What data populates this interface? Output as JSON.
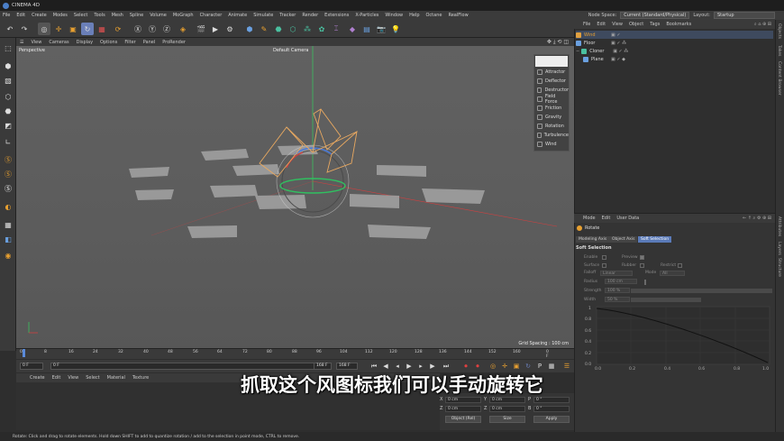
{
  "window": {
    "title": "CINEMA 4D"
  },
  "menubar": {
    "items": [
      "File",
      "Edit",
      "Create",
      "Modes",
      "Select",
      "Tools",
      "Mesh",
      "Spline",
      "Volume",
      "MoGraph",
      "Character",
      "Animate",
      "Simulate",
      "Tracker",
      "Render",
      "Extensions",
      "X-Particles",
      "Window",
      "Help",
      "Octane",
      "RealFlow"
    ],
    "node_space_label": "Node Space:",
    "node_space_value": "Current (Standard/Physical)",
    "layout_label": "Layout:",
    "layout_value": "Startup"
  },
  "viewport": {
    "menu": [
      "View",
      "Cameras",
      "Display",
      "Options",
      "Filter",
      "Panel",
      "ProRender"
    ],
    "label": "Perspective",
    "camera": "Default Camera",
    "grid_spacing": "Grid Spacing : 100 cm"
  },
  "force_menu": {
    "items": [
      "Attractor",
      "Deflector",
      "Destructor",
      "Field Force",
      "Friction",
      "Gravity",
      "Rotation",
      "Turbulence",
      "Wind"
    ]
  },
  "timeline": {
    "ticks": [
      "0",
      "8",
      "16",
      "24",
      "32",
      "40",
      "48",
      "56",
      "64",
      "72",
      "80",
      "88",
      "96",
      "104",
      "112",
      "120",
      "128",
      "136",
      "144",
      "152",
      "160"
    ],
    "end_frame": "0 F"
  },
  "playbar": {
    "current": "0 F",
    "start": "0 F",
    "end1": "168 F",
    "end2": "168 F"
  },
  "material": {
    "menu": [
      "Create",
      "Edit",
      "View",
      "Select",
      "Material",
      "Texture"
    ]
  },
  "coords": {
    "x": "0 cm",
    "y": "0 cm",
    "z": "0 cm",
    "x2": "0 cm",
    "y2": "0 cm",
    "z2": "0 cm",
    "h": "0 °",
    "p": "0 °",
    "b": "0 °",
    "labels": [
      "X",
      "Y",
      "Z",
      "X",
      "Y",
      "Z",
      "H",
      "P",
      "B"
    ],
    "mode": "Object (Rel)",
    "size": "Size",
    "apply": "Apply"
  },
  "object_manager": {
    "menu": [
      "File",
      "Edit",
      "View",
      "Object",
      "Tags",
      "Bookmarks"
    ],
    "objects": [
      {
        "name": "Wind",
        "color": "#e0a040"
      },
      {
        "name": "Floor",
        "color": "#6aa0e0"
      },
      {
        "name": "Cloner",
        "color": "#4ac0a0"
      },
      {
        "name": "Plane",
        "color": "#6aa0e0"
      }
    ]
  },
  "attributes": {
    "menu": [
      "Mode",
      "Edit",
      "User Data"
    ],
    "tool": "Rotate",
    "tabs": [
      "Modeling Axis",
      "Object Axis",
      "Soft Selection"
    ],
    "active_tab": "Soft Selection",
    "section": "Soft Selection",
    "fields": [
      "Enable",
      "Preview",
      "Surface",
      "Rubber",
      "Restrict",
      "Falloff",
      "Linear",
      "Mode",
      "All",
      "Radius",
      "100 cm",
      "Strength",
      "100 %",
      "Width",
      "50 %"
    ],
    "graph_y": [
      "1",
      "0.8",
      "0.6",
      "0.4",
      "0.2",
      "0.0"
    ],
    "graph_x": [
      "0.0",
      "0.2",
      "0.4",
      "0.6",
      "0.8",
      "1.0"
    ]
  },
  "right_strip": [
    "Objects",
    "Takes",
    "Content Browser",
    "Attributes",
    "Layers",
    "Structure"
  ],
  "statusbar": {
    "text": "Rotate: Click and drag to rotate elements. Hold down SHIFT to add to quantize rotation / add to the selection in point mode, CTRL to remove."
  },
  "subtitle": "抓取这个风图标我们可以手动旋转它"
}
